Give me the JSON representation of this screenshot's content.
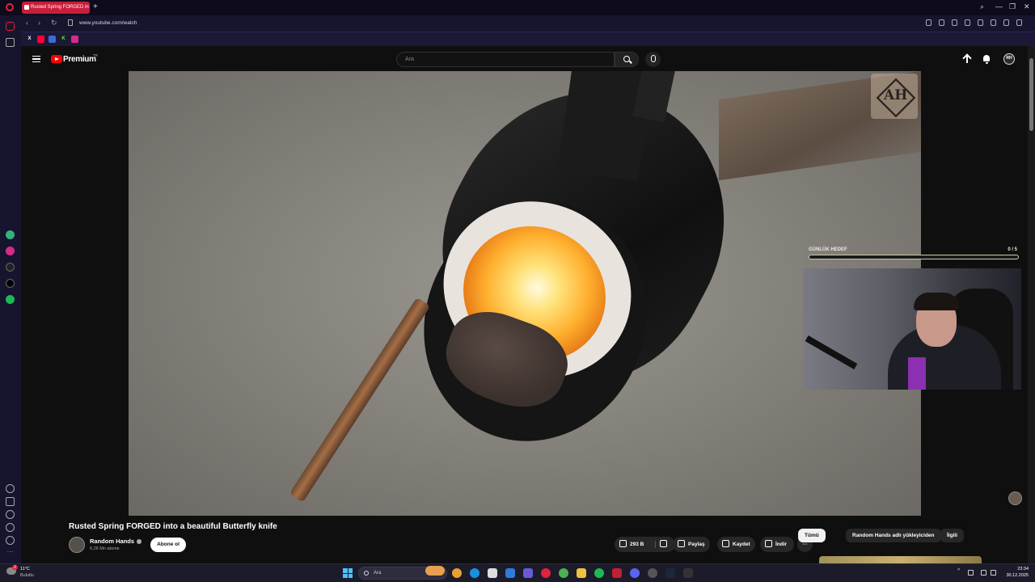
{
  "browser": {
    "tab_title": "Rusted Spring FORGED in",
    "url": "www.youtube.com/watch",
    "new_tab_label": "+",
    "controls": {
      "search": "⌕",
      "minimize": "—",
      "restore": "❐",
      "close": "✕"
    }
  },
  "youtube": {
    "brand": "Premium",
    "brand_sup": "TR",
    "search_placeholder": "Ara",
    "avatar_initials": "RH"
  },
  "overlay": {
    "goal_label": "GÜNLÜK HEDEF",
    "goal_count": "0 / 5",
    "goal_progress": 0
  },
  "video": {
    "title": "Rusted Spring FORGED into a beautiful Butterfly knife",
    "channel": "Random Hands",
    "subscribers": "6,26 Mn abone",
    "subscribe_label": "Abone ol",
    "likes": "293 B",
    "share_label": "Paylaş",
    "save_label": "Kaydet",
    "download_label": "İndir",
    "more_label": "···"
  },
  "chips": [
    {
      "label": "Tümü",
      "active": true
    },
    {
      "label": "Random Hands adlı yükleyiciden",
      "active": false
    },
    {
      "label": "İlgili",
      "active": false
    }
  ],
  "taskbar": {
    "temperature": "11°C",
    "condition": "Bulutlu",
    "weather_badge": "2",
    "search_placeholder": "Ara",
    "time": "23:34",
    "date": "30.12.2025"
  }
}
